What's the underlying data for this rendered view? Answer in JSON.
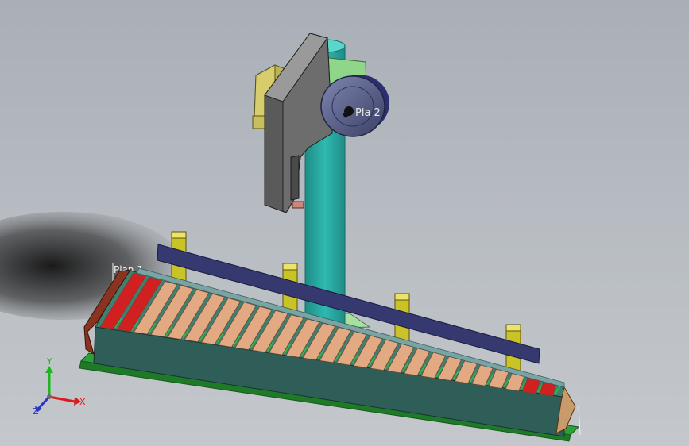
{
  "viewport": {
    "background_top": "#a9afb6",
    "background_bottom": "#c4c8cc"
  },
  "labels": {
    "plane": "Plan 1",
    "wheel_text": "Pla   2"
  },
  "triad": {
    "axis_x": "X",
    "axis_y": "Y",
    "axis_z": "Z",
    "color_x": "#d81b1b",
    "color_y": "#1bb81b",
    "color_z": "#2a35c8"
  },
  "colors": {
    "column": "#27a8a0",
    "gripper_body": "#5a5a5a",
    "motor": "#bcb25a",
    "wheel": "#4a4f7a",
    "conveyor_frame": "#2f5d57",
    "conveyor_base": "#2ea03a",
    "rollers": "#e2a982",
    "roller_end": "#d21f1f",
    "rail": "#35396f",
    "posts": "#c9c327"
  },
  "conveyor": {
    "roller_count": 27
  }
}
